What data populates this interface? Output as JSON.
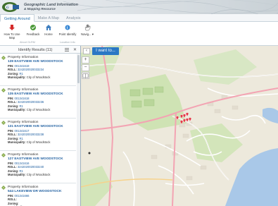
{
  "banner": {
    "logo_mark": "GLRA",
    "line1": "Geographic Land Information",
    "line2": "& Mapping Resource"
  },
  "tabs": [
    {
      "label": "Getting Around",
      "active": true
    },
    {
      "label": "Make A Map",
      "active": false
    },
    {
      "label": "Analysis",
      "active": false
    }
  ],
  "ribbon": {
    "how_to_use_map": "How To Use Map",
    "feedback": "Feedback",
    "home": "Home",
    "point_identify": "Point Identify",
    "navigate": "Navig...",
    "group_about": "About GLRM",
    "group_identify": "Location Info",
    "icons": {
      "how_to_use_map": "arrow-down-icon",
      "feedback": "feedback-icon",
      "home": "home-icon",
      "point_identify": "identify-icon",
      "navigate": "hand-icon"
    }
  },
  "sidebar": {
    "title": "Identify Results (11)",
    "results": [
      {
        "type": "Property Information",
        "address": "139 EASTVIEW AVE WOODSTOCK",
        "pin": "001341619",
        "roll": "3242020020033234",
        "zoning": "R1",
        "municipality": "City of Woodstock"
      },
      {
        "type": "Property Information",
        "address": "135 EASTVIEW AVE WOODSTOCK",
        "pin": "001341618",
        "roll": "3242020020033236",
        "zoning": "R1",
        "municipality": "City of Woodstock"
      },
      {
        "type": "Property Information",
        "address": "131 EASTVIEW AVE WOODSTOCK",
        "pin": "001341617",
        "roll": "3242020020033238",
        "zoning": "R1",
        "municipality": "City of Woodstock"
      },
      {
        "type": "Property Information",
        "address": "127 EASTVIEW AVE WOODSTOCK",
        "pin": "001341616",
        "roll": "3242020020033240",
        "zoning": "R1",
        "municipality": "City of Woodstock"
      },
      {
        "type": "Property Information",
        "address": "544 LAKEVIEW DR WOODSTOCK",
        "pin": "001341666",
        "roll": "",
        "zoning": "",
        "municipality": ""
      }
    ],
    "labels": {
      "pin": "PIN:",
      "roll": "ROLL:",
      "zoning": "Zoning:",
      "municipality": "Municipality:"
    }
  },
  "map": {
    "i_want_to": "I want to...",
    "zoom_in": "+",
    "zoom_out": "−",
    "collapse": "‹",
    "colors": {
      "land": "#ede9dc",
      "park": "#c9dfb0",
      "water": "#a9c8e8",
      "road_major": "#f7a6b5",
      "road_minor": "#ffffff",
      "building": "#d9d2c5",
      "marker": "#e23c4a"
    }
  }
}
